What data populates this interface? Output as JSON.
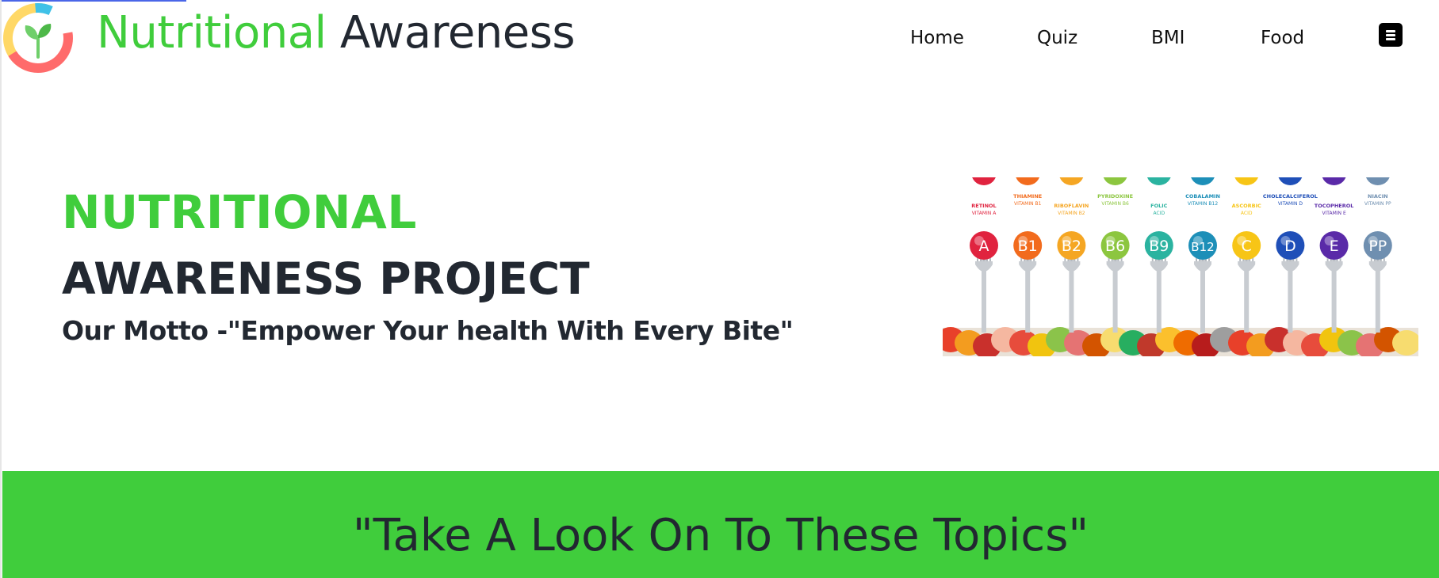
{
  "brand": {
    "name_part1": "Nutritional",
    "name_part2": "Awareness"
  },
  "nav": {
    "items": [
      "Home",
      "Quiz",
      "BMI",
      "Food"
    ],
    "menu_icon": "hamburger-menu-icon"
  },
  "hero": {
    "title_line1": "NUTRITIONAL",
    "title_line2": "AWARENESS PROJECT",
    "motto": "Our Motto -\"Empower Your health With Every Bite\""
  },
  "vitamins": [
    {
      "letter": "A",
      "name": "RETINOL",
      "sub": "VITAMIN A",
      "color": "#e0233f"
    },
    {
      "letter": "B1",
      "name": "THIAMINE",
      "sub": "VITAMIN B1",
      "color": "#f26b1d"
    },
    {
      "letter": "B2",
      "name": "RIBOFLAVIN",
      "sub": "VITAMIN B2",
      "color": "#f5a623"
    },
    {
      "letter": "B6",
      "name": "PYRIDOXINE",
      "sub": "VITAMIN B6",
      "color": "#8cc63f"
    },
    {
      "letter": "B9",
      "name": "FOLIC",
      "sub": "ACID",
      "color": "#2bb3a0"
    },
    {
      "letter": "B12",
      "name": "COBALAMIN",
      "sub": "VITAMIN B12",
      "color": "#1d8fb8"
    },
    {
      "letter": "C",
      "name": "ASCORBIC",
      "sub": "ACID",
      "color": "#f7c516"
    },
    {
      "letter": "D",
      "name": "CHOLECALCIFEROL",
      "sub": "VITAMIN D",
      "color": "#1f4fb8"
    },
    {
      "letter": "E",
      "name": "TOCOPHEROL",
      "sub": "VITAMIN E",
      "color": "#5a2aa8"
    },
    {
      "letter": "PP",
      "name": "NIACIN",
      "sub": "VITAMIN PP",
      "color": "#6f8fb0"
    }
  ],
  "banner": {
    "text": "\"Take A Look On To These Topics\""
  },
  "colors": {
    "accent_green": "#40cd3c",
    "dark_text": "#222831"
  }
}
